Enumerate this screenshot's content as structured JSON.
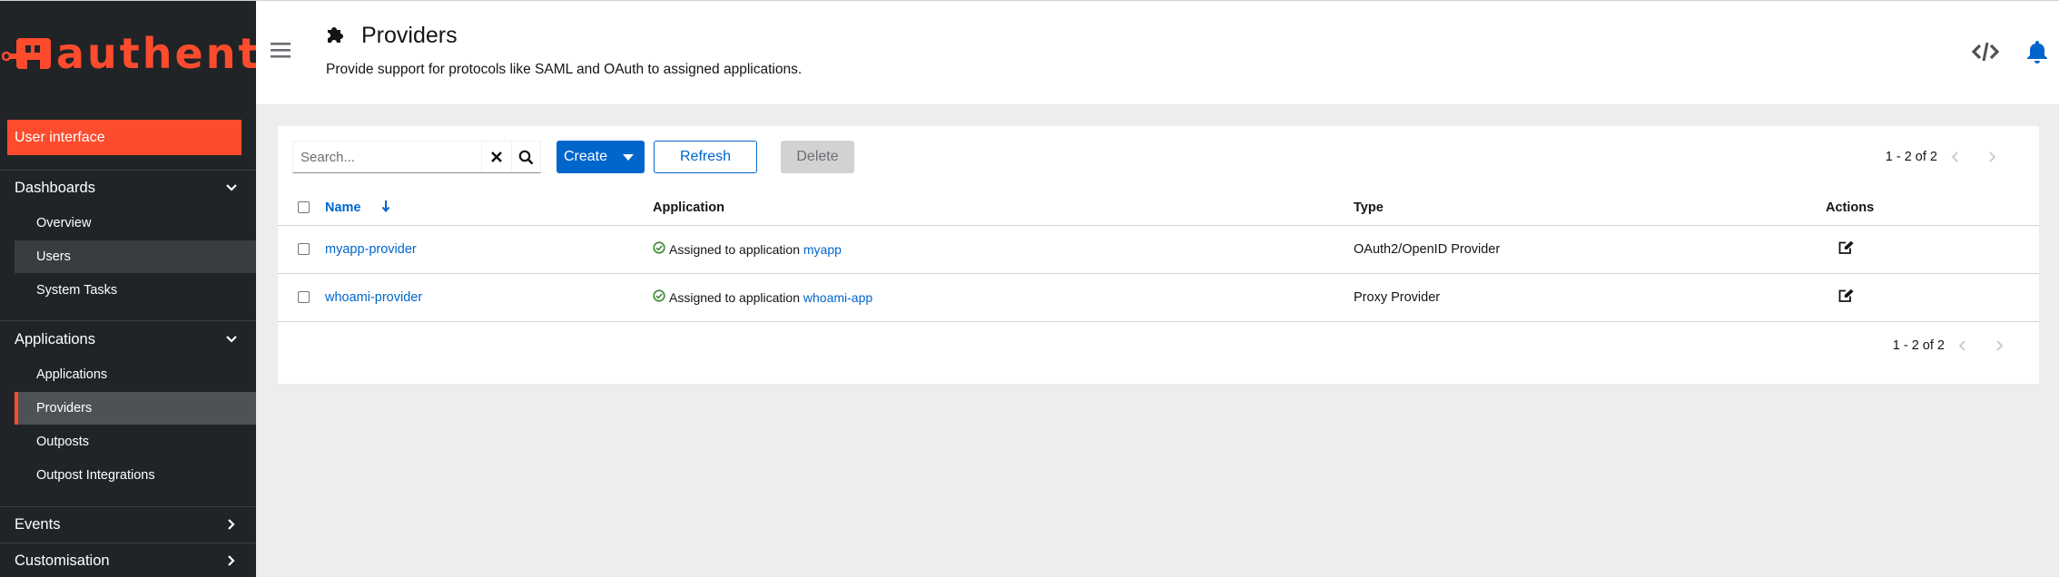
{
  "sidebar": {
    "brand": "authentik",
    "user_interface_label": "User interface",
    "groups": [
      {
        "label": "Dashboards",
        "items": [
          "Overview",
          "Users",
          "System Tasks"
        ]
      },
      {
        "label": "Applications",
        "items": [
          "Applications",
          "Providers",
          "Outposts",
          "Outpost Integrations"
        ]
      },
      {
        "label": "Events"
      },
      {
        "label": "Customisation"
      }
    ],
    "active_item": "Providers",
    "hover_item": "Users",
    "accent_color": "#fd4b2d"
  },
  "header": {
    "title": "Providers",
    "description": "Provide support for protocols like SAML and OAuth to assigned applications.",
    "title_icon": "puzzle-icon",
    "right_icons": [
      "code-icon",
      "bell-icon"
    ]
  },
  "toolbar": {
    "search_placeholder": "Search...",
    "search_value": "",
    "create_label": "Create",
    "refresh_label": "Refresh",
    "delete_label": "Delete",
    "pagination_text": "1 - 2 of 2"
  },
  "table": {
    "columns": [
      "Name",
      "Application",
      "Type",
      "Actions"
    ],
    "sort_column": "Name",
    "rows": [
      {
        "name": "myapp-provider",
        "application_prefix": "Assigned to application",
        "application": "myapp",
        "type": "OAuth2/OpenID Provider"
      },
      {
        "name": "whoami-provider",
        "application_prefix": "Assigned to application",
        "application": "whoami-app",
        "type": "Proxy Provider"
      }
    ]
  },
  "footer": {
    "pagination_text": "1 - 2 of 2"
  },
  "colors": {
    "primary": "#0066cc",
    "brand": "#fd4b2d",
    "success": "#3e8635",
    "sidebar_bg": "#212427"
  }
}
